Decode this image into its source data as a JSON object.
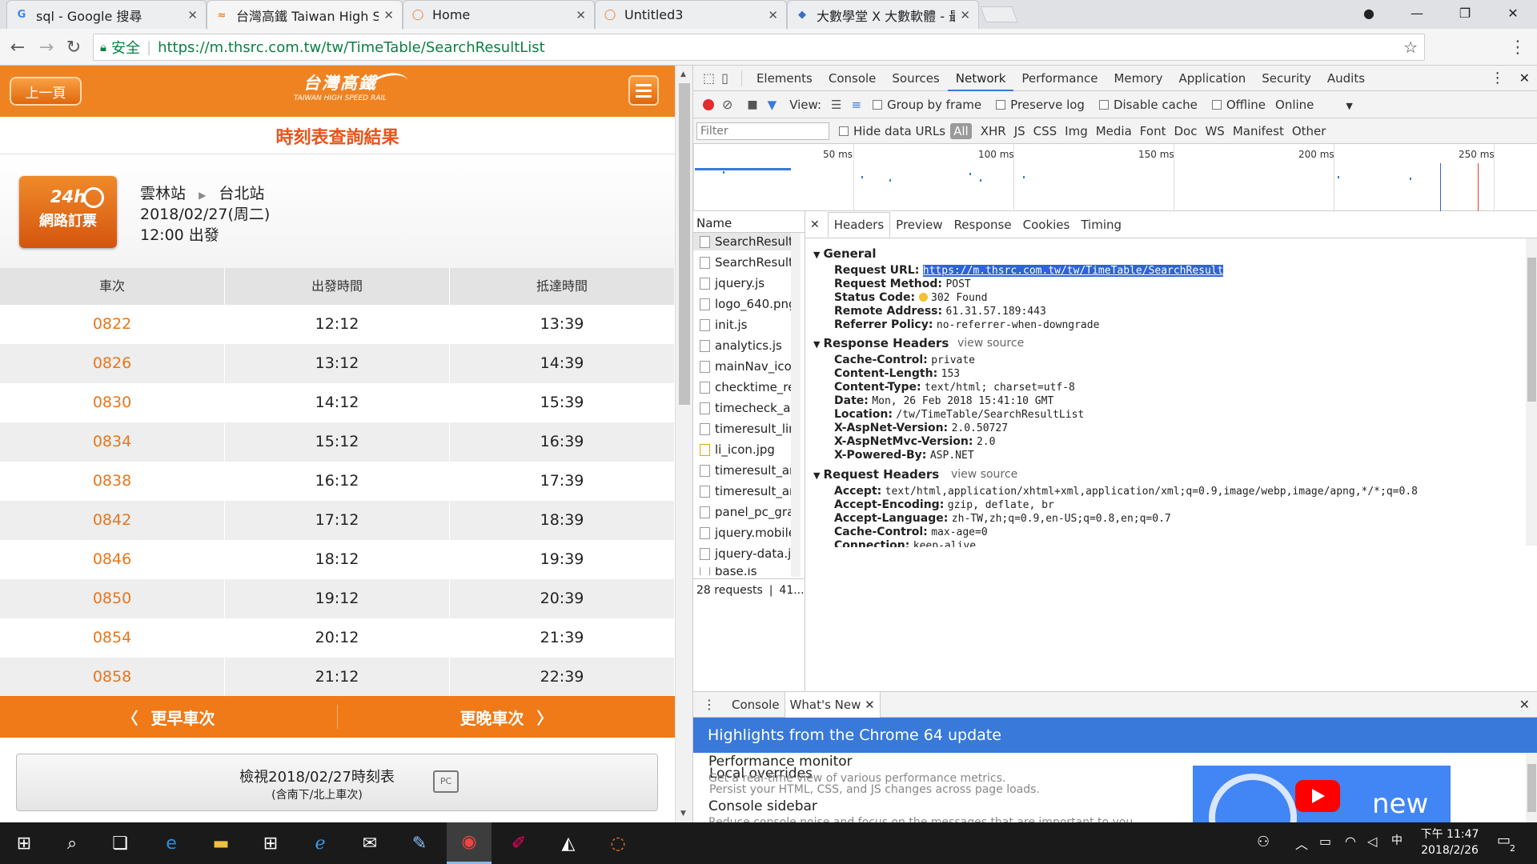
{
  "browser": {
    "tabs": [
      {
        "title": "sql - Google 搜尋",
        "icon": "google-icon"
      },
      {
        "title": "台灣高鐵 Taiwan High S",
        "icon": "thsr-icon",
        "active": true
      },
      {
        "title": "Home",
        "icon": "jupyter-icon"
      },
      {
        "title": "Untitled3",
        "icon": "jupyter-icon"
      },
      {
        "title": "大數學堂 X 大數軟體 - 最",
        "icon": "dataschool-icon"
      }
    ],
    "secure_label": "安全",
    "url": "https://m.thsrc.com.tw/tw/TimeTable/SearchResultList"
  },
  "thsr": {
    "back_label": "上一頁",
    "logo_zh": "台灣高鐵",
    "logo_en": "TAIWAN HIGH SPEED RAIL",
    "page_title": "時刻表查詢結果",
    "badge_top": "24h",
    "badge_label": "網路訂票",
    "from_station": "雲林站",
    "to_station": "台北站",
    "date": "2018/02/27(周二)",
    "depart": "12:00 出發",
    "columns": [
      "車次",
      "出發時間",
      "抵達時間"
    ],
    "trains": [
      {
        "no": "0822",
        "dep": "12:12",
        "arr": "13:39"
      },
      {
        "no": "0826",
        "dep": "13:12",
        "arr": "14:39"
      },
      {
        "no": "0830",
        "dep": "14:12",
        "arr": "15:39"
      },
      {
        "no": "0834",
        "dep": "15:12",
        "arr": "16:39"
      },
      {
        "no": "0838",
        "dep": "16:12",
        "arr": "17:39"
      },
      {
        "no": "0842",
        "dep": "17:12",
        "arr": "18:39"
      },
      {
        "no": "0846",
        "dep": "18:12",
        "arr": "19:39"
      },
      {
        "no": "0850",
        "dep": "19:12",
        "arr": "20:39"
      },
      {
        "no": "0854",
        "dep": "20:12",
        "arr": "21:39"
      },
      {
        "no": "0858",
        "dep": "21:12",
        "arr": "22:39"
      }
    ],
    "earlier": "更早車次",
    "later": "更晚車次",
    "view_timetable": "檢視2018/02/27時刻表",
    "view_timetable_sub": "(含南下/北上車次)",
    "pc_label": "PC"
  },
  "devtools": {
    "tabs": [
      "Elements",
      "Console",
      "Sources",
      "Network",
      "Performance",
      "Memory",
      "Application",
      "Security",
      "Audits"
    ],
    "active_tab": "Network",
    "view_label": "View:",
    "group_by_frame": "Group by frame",
    "preserve_log": "Preserve log",
    "disable_cache": "Disable cache",
    "offline": "Offline",
    "throttle": "Online",
    "filter_placeholder": "Filter",
    "hide_data_urls": "Hide data URLs",
    "type_filters": [
      "All",
      "XHR",
      "JS",
      "CSS",
      "Img",
      "Media",
      "Font",
      "Doc",
      "WS",
      "Manifest",
      "Other"
    ],
    "timeline_ticks": [
      "50 ms",
      "100 ms",
      "150 ms",
      "200 ms",
      "250 ms"
    ],
    "name_header": "Name",
    "requests": [
      "SearchResult",
      "SearchResultl",
      "jquery.js",
      "logo_640.png",
      "init.js",
      "analytics.js",
      "mainNav_ico.",
      "checktime_re",
      "timecheck_ar",
      "timeresult_lin",
      "li_icon.jpg",
      "timeresult_ar",
      "timeresult_ar",
      "panel_pc_gra",
      "jquery.mobile",
      "jquery-data.js",
      "base.js"
    ],
    "status_bar": "28 requests ❘ 41....",
    "detail_tabs": [
      "Headers",
      "Preview",
      "Response",
      "Cookies",
      "Timing"
    ],
    "general": {
      "title": "General",
      "request_url_label": "Request URL:",
      "request_url": "https://m.thsrc.com.tw/tw/TimeTable/SearchResult",
      "method_label": "Request Method:",
      "method": "POST",
      "status_label": "Status Code:",
      "status": "302 Found",
      "remote_label": "Remote Address:",
      "remote": "61.31.57.189:443",
      "referrer_label": "Referrer Policy:",
      "referrer": "no-referrer-when-downgrade"
    },
    "response_headers": {
      "title": "Response Headers",
      "view_source": "view source",
      "rows": [
        {
          "k": "Cache-Control:",
          "v": "private"
        },
        {
          "k": "Content-Length:",
          "v": "153"
        },
        {
          "k": "Content-Type:",
          "v": "text/html; charset=utf-8"
        },
        {
          "k": "Date:",
          "v": "Mon, 26 Feb 2018 15:41:10 GMT"
        },
        {
          "k": "Location:",
          "v": "/tw/TimeTable/SearchResultList"
        },
        {
          "k": "X-AspNet-Version:",
          "v": "2.0.50727"
        },
        {
          "k": "X-AspNetMvc-Version:",
          "v": "2.0"
        },
        {
          "k": "X-Powered-By:",
          "v": "ASP.NET"
        }
      ]
    },
    "request_headers": {
      "title": "Request Headers",
      "view_source": "view source",
      "rows": [
        {
          "k": "Accept:",
          "v": "text/html,application/xhtml+xml,application/xml;q=0.9,image/webp,image/apng,*/*;q=0.8"
        },
        {
          "k": "Accept-Encoding:",
          "v": "gzip, deflate, br"
        },
        {
          "k": "Accept-Language:",
          "v": "zh-TW,zh;q=0.9,en-US;q=0.8,en;q=0.7"
        },
        {
          "k": "Cache-Control:",
          "v": "max-age=0"
        },
        {
          "k": "Connection:",
          "v": "keep-alive"
        }
      ]
    },
    "drawer": {
      "tabs": [
        "Console",
        "What's New"
      ],
      "banner": "Highlights from the Chrome 64 update",
      "features": [
        {
          "title": "Local overrides",
          "desc": "Persist your HTML, CSS, and JS changes across page loads."
        },
        {
          "title": "Performance monitor",
          "desc": "Get a real-time view of various performance metrics."
        },
        {
          "title": "Console sidebar",
          "desc": "Reduce console noise and focus on the messages that are important to you."
        }
      ],
      "promo_text": "new"
    }
  },
  "taskbar": {
    "time": "下午 11:47",
    "date": "2018/2/26",
    "notification_count": "2"
  },
  "colors": {
    "thsr_orange": "#ef8322",
    "devtools_blue": "#3879d9",
    "train_no": "#e8761a",
    "title_red": "#e8541a"
  }
}
